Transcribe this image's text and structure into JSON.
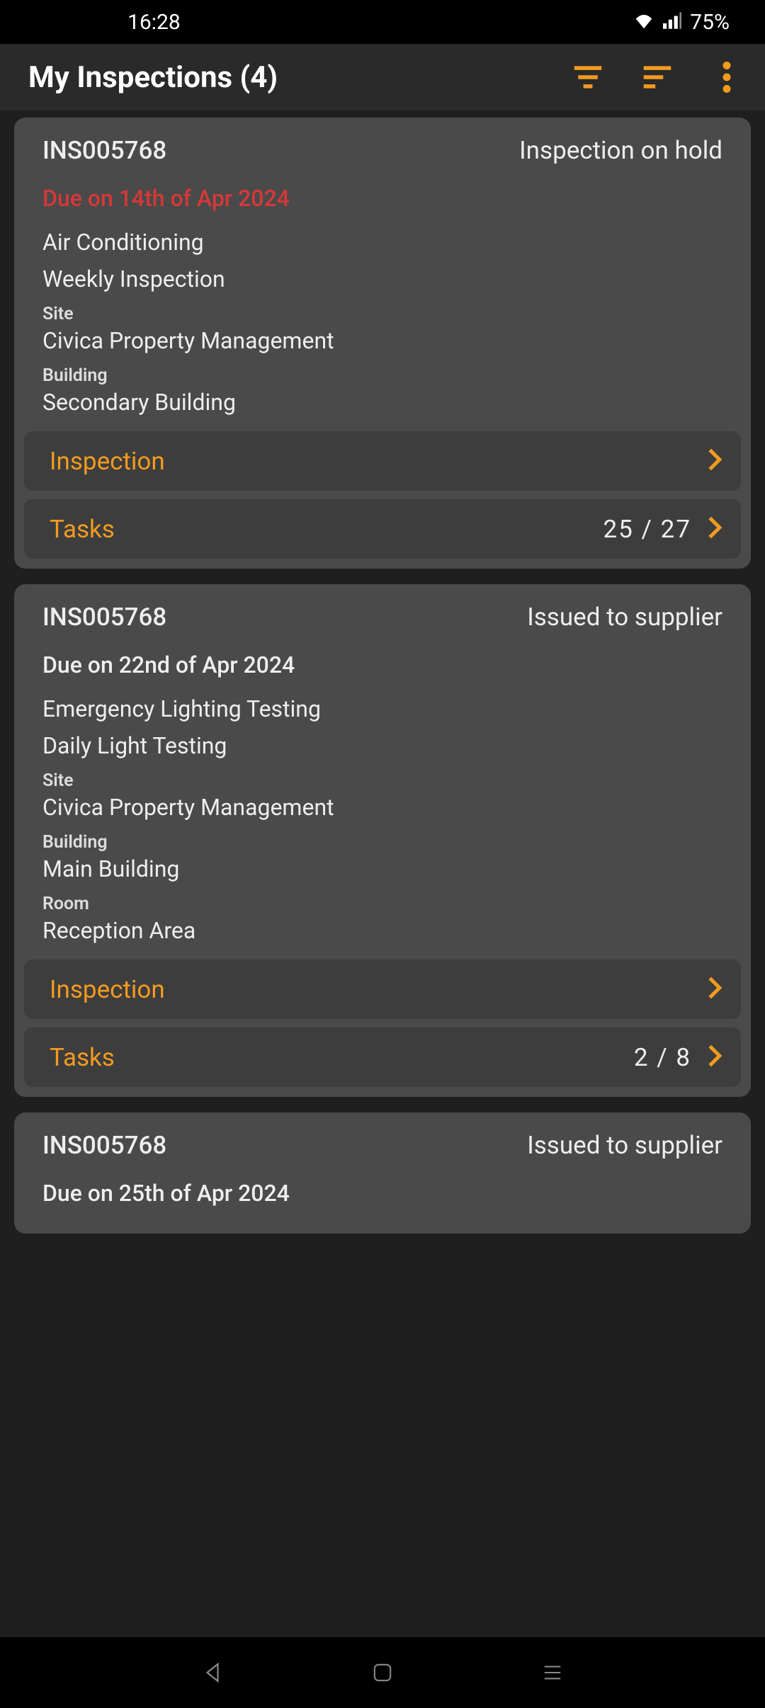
{
  "status_bar": {
    "time": "16:28",
    "battery": "75%"
  },
  "header": {
    "title": "My Inspections (4)"
  },
  "cards": [
    {
      "id": "INS005768",
      "status": "Inspection on hold",
      "due": "Due on 14th of Apr 2024",
      "due_overdue": true,
      "line1": "Air Conditioning",
      "line2": "Weekly Inspection",
      "site_label": "Site",
      "site": "Civica Property Management",
      "building_label": "Building",
      "building": "Secondary Building",
      "inspection_label": "Inspection",
      "tasks_label": "Tasks",
      "tasks_count": "25 / 27"
    },
    {
      "id": "INS005768",
      "status": "Issued to supplier",
      "due": "Due on 22nd of Apr 2024",
      "due_overdue": false,
      "line1": "Emergency Lighting Testing",
      "line2": "Daily Light Testing",
      "site_label": "Site",
      "site": "Civica Property Management",
      "building_label": "Building",
      "building": "Main Building",
      "room_label": "Room",
      "room": "Reception Area",
      "inspection_label": "Inspection",
      "tasks_label": "Tasks",
      "tasks_count": "2 / 8"
    },
    {
      "id": "INS005768",
      "status": "Issued to supplier",
      "due": "Due on 25th of Apr 2024",
      "due_overdue": false
    }
  ]
}
